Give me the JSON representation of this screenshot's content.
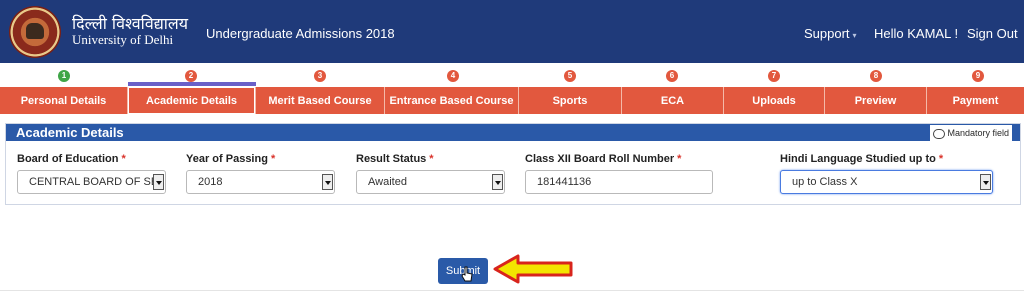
{
  "header": {
    "univ_hindi": "दिल्ली विश्वविद्यालय",
    "univ_english": "University of Delhi",
    "app_title": "Undergraduate Admissions 2018",
    "support": "Support",
    "support_caret": "▾",
    "greeting": "Hello KAMAL !",
    "sign_out": "Sign Out"
  },
  "steps": [
    "1",
    "2",
    "3",
    "4",
    "5",
    "6",
    "7",
    "8",
    "9"
  ],
  "tabs": [
    "Personal Details",
    "Academic Details",
    "Merit Based Course",
    "Entrance Based Course",
    "Sports",
    "ECA",
    "Uploads",
    "Preview",
    "Payment"
  ],
  "panel": {
    "title": "Academic Details",
    "mandatory_note": "Mandatory field",
    "fields": [
      {
        "label": "Board of Education",
        "value": "CENTRAL BOARD OF SE"
      },
      {
        "label": "Year of Passing",
        "value": "2018"
      },
      {
        "label": "Result Status",
        "value": "Awaited"
      },
      {
        "label": "Class XII Board Roll Number",
        "value": "181441136"
      },
      {
        "label": "Hindi Language Studied up to",
        "value": "up to Class X"
      }
    ],
    "required_mark": "*"
  },
  "submit_label": "Submit",
  "colors": {
    "header_bg": "#1f3a7a",
    "tab_bg": "#e2583e",
    "step_done": "#3fa547",
    "panel_head": "#2a59a8",
    "submit_bg": "#2a5aa8",
    "arrow_fill": "#f3e500",
    "arrow_stroke": "#d8241c"
  }
}
